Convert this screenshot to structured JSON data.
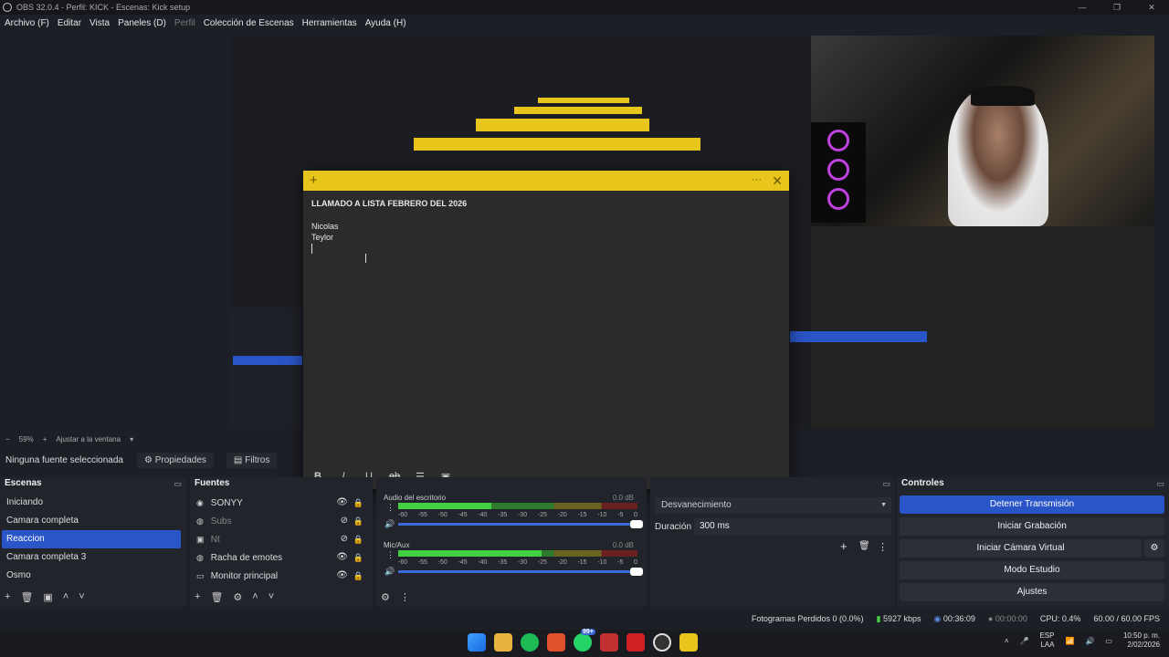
{
  "window": {
    "title": "OBS 32.0.4 - Perfil: KICK - Escenas: Kick setup"
  },
  "menu": [
    "Archivo (F)",
    "Editar",
    "Vista",
    "Paneles (D)",
    "Perfil",
    "Colección de Escenas",
    "Herramientas",
    "Ayuda (H)"
  ],
  "note": {
    "heading": "LLAMADO A LISTA FEBRERO DEL 2026",
    "lines": [
      "Nicolas",
      "Teylor"
    ]
  },
  "zoom": {
    "value": "59%",
    "fit": "Ajustar a la ventana"
  },
  "source_toolbar": {
    "no_source": "Ninguna fuente seleccionada",
    "properties": "Propiedades",
    "filters": "Filtros"
  },
  "scenes": {
    "title": "Escenas",
    "items": [
      "Iniciando",
      "Camara completa",
      "Reaccion",
      "Camara completa 3",
      "Osmo"
    ],
    "selected": "Reaccion"
  },
  "sources": {
    "title": "Fuentes",
    "items": [
      {
        "name": "SONYY",
        "icon": "camera-icon",
        "visible": true
      },
      {
        "name": "Subs",
        "icon": "globe-icon",
        "visible": false
      },
      {
        "name": "Nt",
        "icon": "image-icon",
        "visible": false
      },
      {
        "name": "Racha de emotes",
        "icon": "globe-icon",
        "visible": true
      },
      {
        "name": "Monitor principal",
        "icon": "monitor-icon",
        "visible": true
      }
    ]
  },
  "mixer": {
    "tracks": [
      {
        "name": "Audio del escritorio",
        "db": "0.0 dB",
        "level": 0.39
      },
      {
        "name": "Mic/Aux",
        "db": "0.0 dB",
        "level": 0.6
      }
    ],
    "scale": [
      "-60",
      "-55",
      "-50",
      "-45",
      "-40",
      "-35",
      "-30",
      "-25",
      "-20",
      "-15",
      "-10",
      "-5",
      "0"
    ]
  },
  "transitions": {
    "type": "Desvanecimiento",
    "duration_label": "Duración",
    "duration": "300 ms"
  },
  "controls": {
    "title": "Controles",
    "stop_stream": "Detener Transmisión",
    "start_recording": "Iniciar Grabación",
    "start_virtual_cam": "Iniciar Cámara Virtual",
    "studio_mode": "Modo Estudio",
    "settings": "Ajustes"
  },
  "status": {
    "dropped": "Fotogramas Perdidos 0 (0.0%)",
    "bitrate": "5927 kbps",
    "stream_time": "00:36:09",
    "rec_time": "00:00:00",
    "cpu": "CPU: 0.4%",
    "fps": "60.00 / 60.00 FPS"
  },
  "taskbar": {
    "lang1": "ESP",
    "lang2": "LAA",
    "time": "10:50 p. m.",
    "date": "2/02/2026",
    "badge": "99+"
  }
}
